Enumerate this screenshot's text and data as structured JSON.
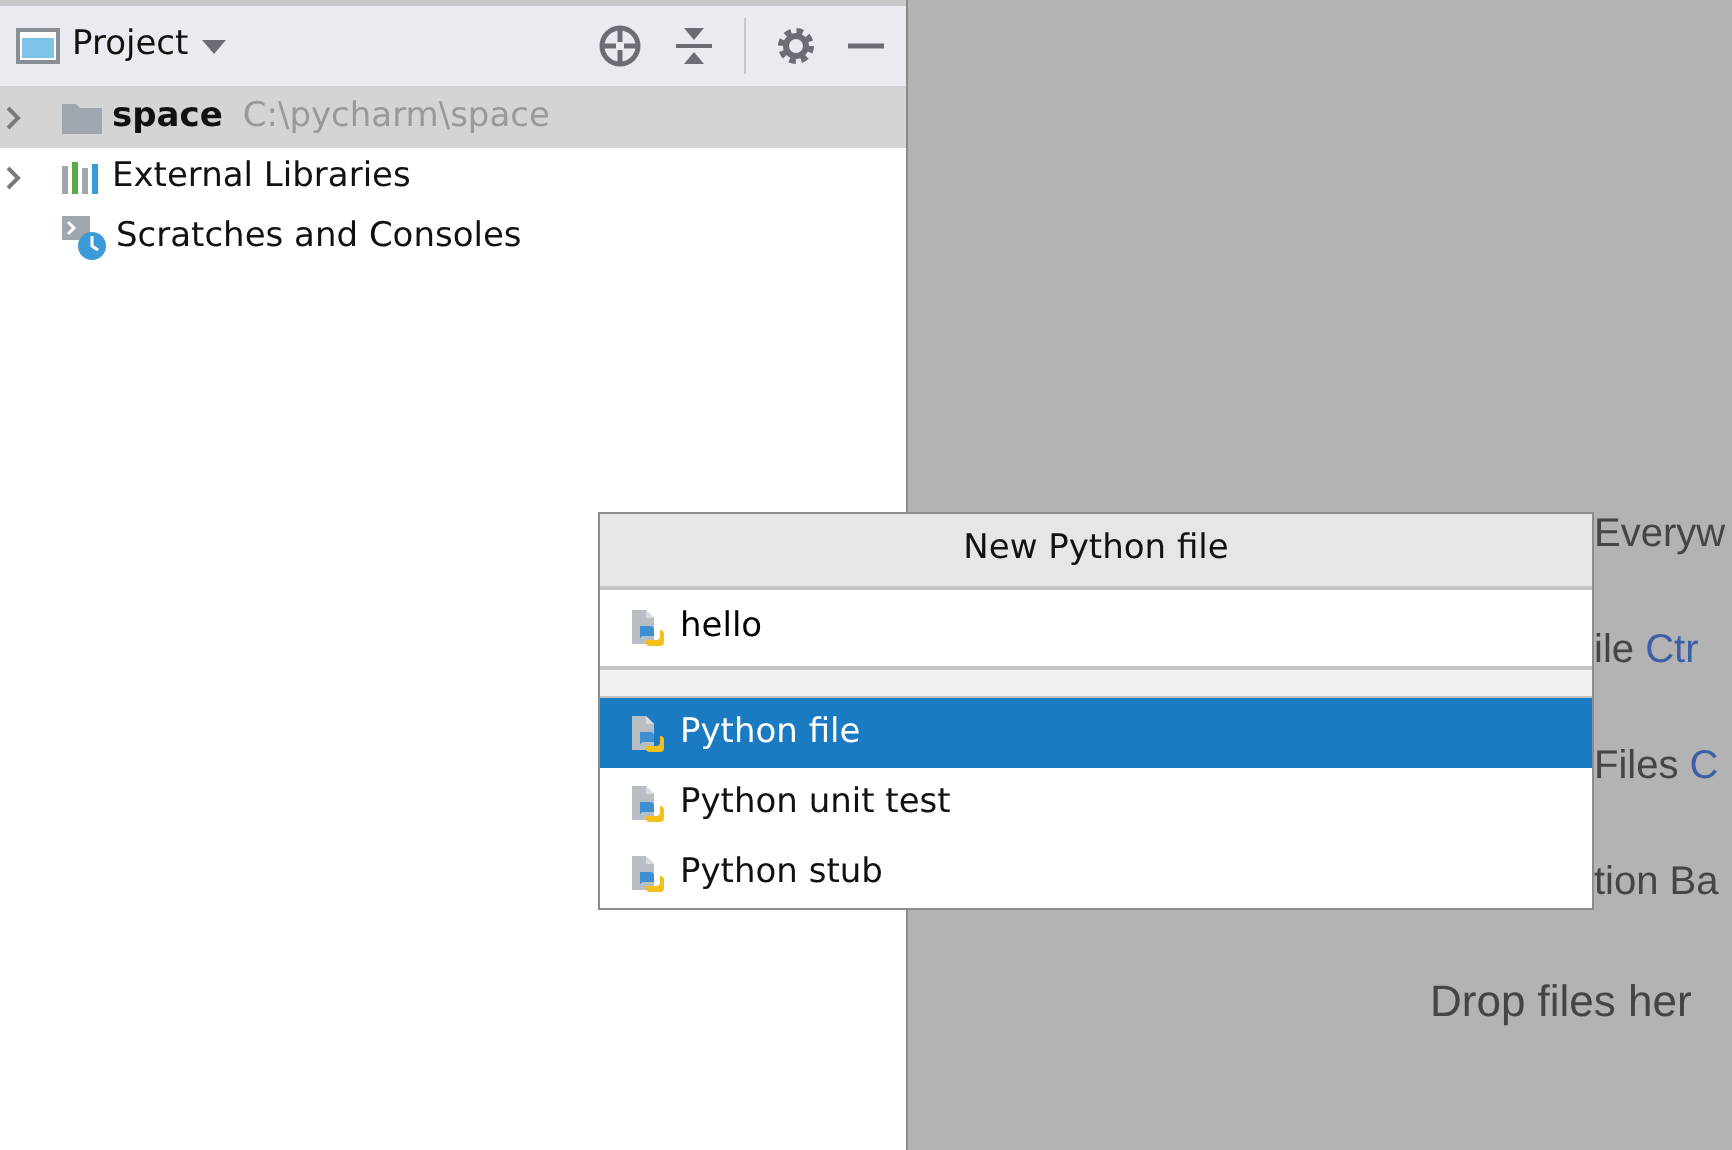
{
  "project_panel": {
    "title": "Project",
    "tree": [
      {
        "kind": "folder",
        "label": "space",
        "path": "C:\\pycharm\\space",
        "selected": true,
        "expandable": true
      },
      {
        "kind": "libraries",
        "label": "External Libraries",
        "selected": false,
        "expandable": true
      },
      {
        "kind": "scratches",
        "label": "Scratches and Consoles",
        "selected": false,
        "expandable": false
      }
    ]
  },
  "editor_hints": [
    {
      "kind": "action",
      "parts": [
        {
          "text": "Everyw",
          "kind": "plain"
        }
      ]
    },
    {
      "kind": "action",
      "parts": [
        {
          "text": "ile",
          "kind": "plain"
        },
        {
          "text": "Ctr",
          "kind": "shortcut"
        }
      ]
    },
    {
      "kind": "action",
      "parts": [
        {
          "text": "Files",
          "kind": "plain"
        },
        {
          "text": "C",
          "kind": "shortcut"
        }
      ]
    },
    {
      "kind": "action",
      "parts": [
        {
          "text": "tion Ba",
          "kind": "plain"
        }
      ]
    },
    {
      "kind": "drop",
      "parts": [
        {
          "text": "Drop files her",
          "kind": "plain"
        }
      ]
    }
  ],
  "popup": {
    "title": "New Python file",
    "input": {
      "value": "hello"
    },
    "items": [
      {
        "label": "Python file",
        "selected": true
      },
      {
        "label": "Python unit test",
        "selected": false
      },
      {
        "label": "Python stub",
        "selected": false
      }
    ]
  }
}
